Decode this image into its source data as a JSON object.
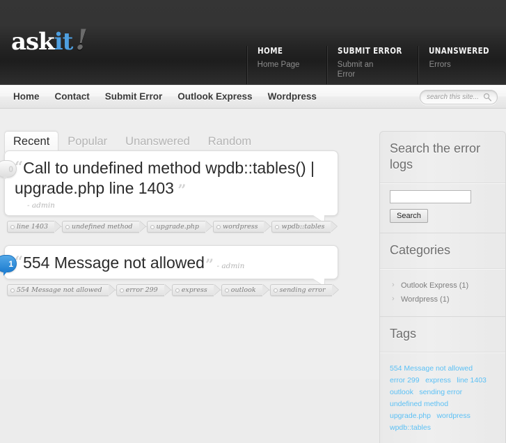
{
  "site": {
    "logo_ask": "ask",
    "logo_it": "it",
    "logo_bang": "!"
  },
  "header": {
    "top_nav": [
      {
        "title": "HOME",
        "desc": "Home Page"
      },
      {
        "title": "SUBMIT ERROR",
        "desc": "Submit an Error"
      },
      {
        "title": "UNANSWERED",
        "desc": "Errors"
      }
    ]
  },
  "navbar": {
    "items": [
      {
        "label": "Home"
      },
      {
        "label": "Contact"
      },
      {
        "label": "Submit Error"
      },
      {
        "label": "Outlook Express"
      },
      {
        "label": "Wordpress"
      }
    ],
    "search": {
      "value": "",
      "placeholder": "search this site...",
      "icon": "search-icon"
    }
  },
  "tabs": [
    {
      "label": "Recent",
      "active": true
    },
    {
      "label": "Popular",
      "active": false
    },
    {
      "label": "Unanswered",
      "active": false
    },
    {
      "label": "Random",
      "active": false
    }
  ],
  "posts": [
    {
      "count": "0",
      "count_state": "zero",
      "title": "Call to undefined method wpdb::tables() | upgrade.php line 1403",
      "byline": "- admin",
      "byline_inline": false,
      "quote_open": "“",
      "quote_close": "”",
      "tags": [
        "line 1403",
        "undefined method",
        "upgrade.php",
        "wordpress",
        "wpdb::tables"
      ]
    },
    {
      "count": "1",
      "count_state": "has",
      "title": "554 Message not allowed",
      "byline": "- admin",
      "byline_inline": true,
      "quote_open": "“",
      "quote_close": "”",
      "tags": [
        "554 Message not allowed",
        "error 299",
        "express",
        "outlook",
        "sending error"
      ]
    }
  ],
  "sidebar": {
    "search_widget": {
      "title": "Search the error logs",
      "input_value": "",
      "button_label": "Search"
    },
    "categories_widget": {
      "title": "Categories",
      "items": [
        "Outlook Express (1)",
        "Wordpress (1)"
      ]
    },
    "tags_widget": {
      "title": "Tags",
      "tags": [
        "554 Message not allowed",
        "error 299",
        "express",
        "line 1403",
        "outlook",
        "sending error",
        "undefined method",
        "upgrade.php",
        "wordpress",
        "wpdb::tables"
      ]
    }
  },
  "colors": {
    "accent_blue": "#4e9fe0",
    "tag_link_blue": "#5bc0f5",
    "header_dark": "#2b2b2b",
    "page_bg": "#eeeeee"
  }
}
